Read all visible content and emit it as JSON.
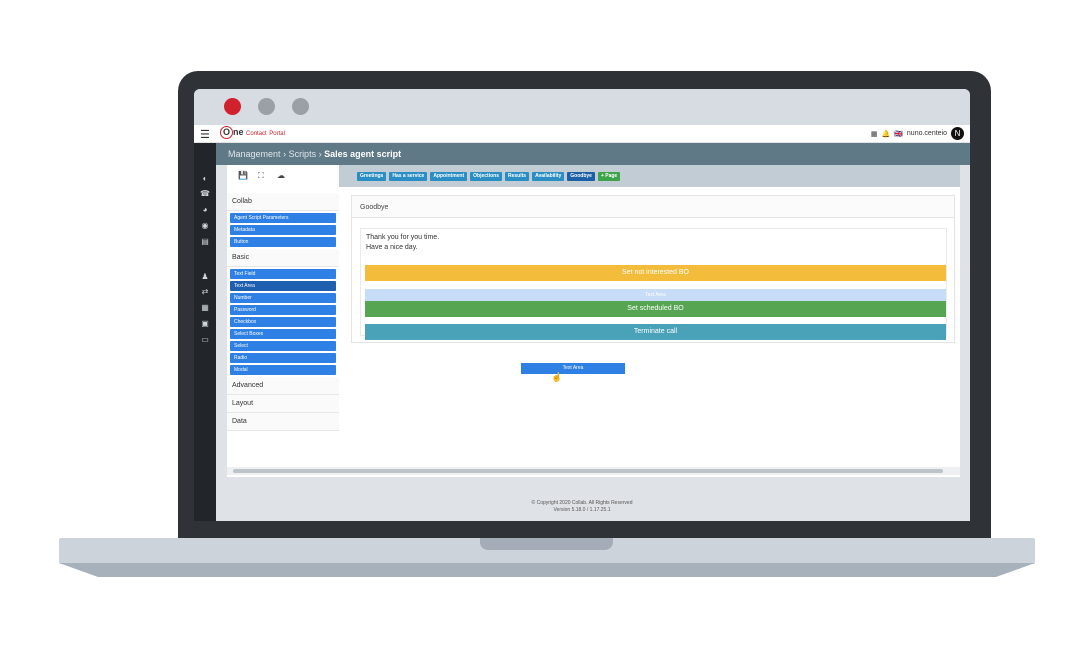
{
  "app": {
    "logo_main": "ne",
    "logo_lead": "O",
    "logo_sub1": "Contact",
    "logo_sub2": "Portal",
    "user_name": "nuno.centeio",
    "user_initial": "N"
  },
  "breadcrumb": {
    "root": "Management",
    "mid": "Scripts",
    "current": "Sales agent script"
  },
  "toolbar": {
    "save_icon": "floppy-icon",
    "expand_icon": "expand-icon",
    "upload_icon": "cloud-upload-icon"
  },
  "tabs": [
    "Greetings",
    "Has a service",
    "Appointment",
    "Objections",
    "Results",
    "Availability",
    "Goodbye",
    "+ Page"
  ],
  "palette": {
    "collab_label": "Collab",
    "collab_items": [
      "Agent Script Parameters",
      "Metadata",
      "Button"
    ],
    "basic_label": "Basic",
    "basic_items": [
      "Text Field",
      "Text Area",
      "Number",
      "Password",
      "Checkbox",
      "Select Boxes",
      "Select",
      "Radio",
      "Modal"
    ],
    "advanced_label": "Advanced",
    "layout_label": "Layout",
    "data_label": "Data"
  },
  "editor": {
    "title": "Goodbye",
    "text_line1": "Thank you for you time.",
    "text_line2": "Have a nice day.",
    "btn_not_interested": "Set not interested BO",
    "btn_scheduled": "Set scheduled BO",
    "btn_terminate": "Terminate call",
    "drag_label": "Text Area",
    "ghost_label": "Text Area"
  },
  "footer": {
    "copyright": "© Copyright 2020 Collab. All Rights Reserved",
    "version": "Version 5.18.0 / 1.17.25.1"
  },
  "colors": {
    "accent_blue": "#2f80e4",
    "warning_yellow": "#f3bc3a",
    "success_green": "#55a552",
    "info_teal": "#4aa2b8",
    "mac_red": "#d0212d"
  }
}
